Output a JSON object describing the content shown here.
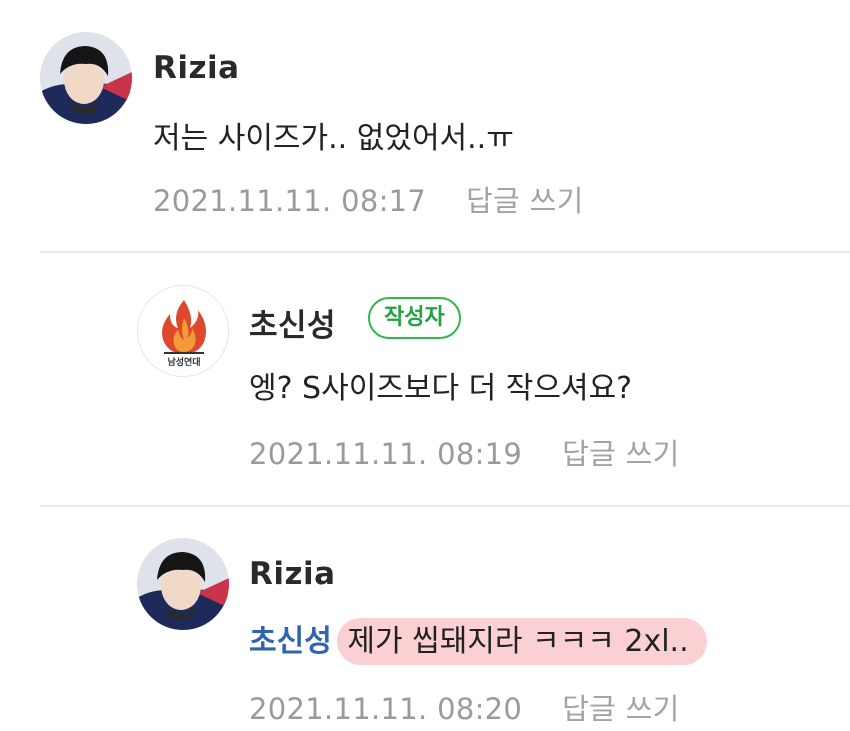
{
  "comments": [
    {
      "author": "Rizia",
      "text": "저는 사이즈가.. 없었어서..ㅠ",
      "timestamp": "2021.11.11. 08:17",
      "reply_label": "답글 쓰기"
    },
    {
      "author": "초신성",
      "badge": "작성자",
      "avatar_logo_text": "남성연대",
      "text": "엥? S사이즈보다 더 작으셔요?",
      "timestamp": "2021.11.11. 08:19",
      "reply_label": "답글 쓰기"
    },
    {
      "author": "Rizia",
      "mention": "초신성",
      "text": "제가 씹돼지라 ㅋㅋㅋ 2xl..",
      "timestamp": "2021.11.11. 08:20",
      "reply_label": "답글 쓰기"
    }
  ],
  "colors": {
    "badge_green": "#2fb84c",
    "mention_blue": "#2f63b3",
    "highlight_pink": "#f5aaaf",
    "meta_gray": "#9a9a9a"
  }
}
